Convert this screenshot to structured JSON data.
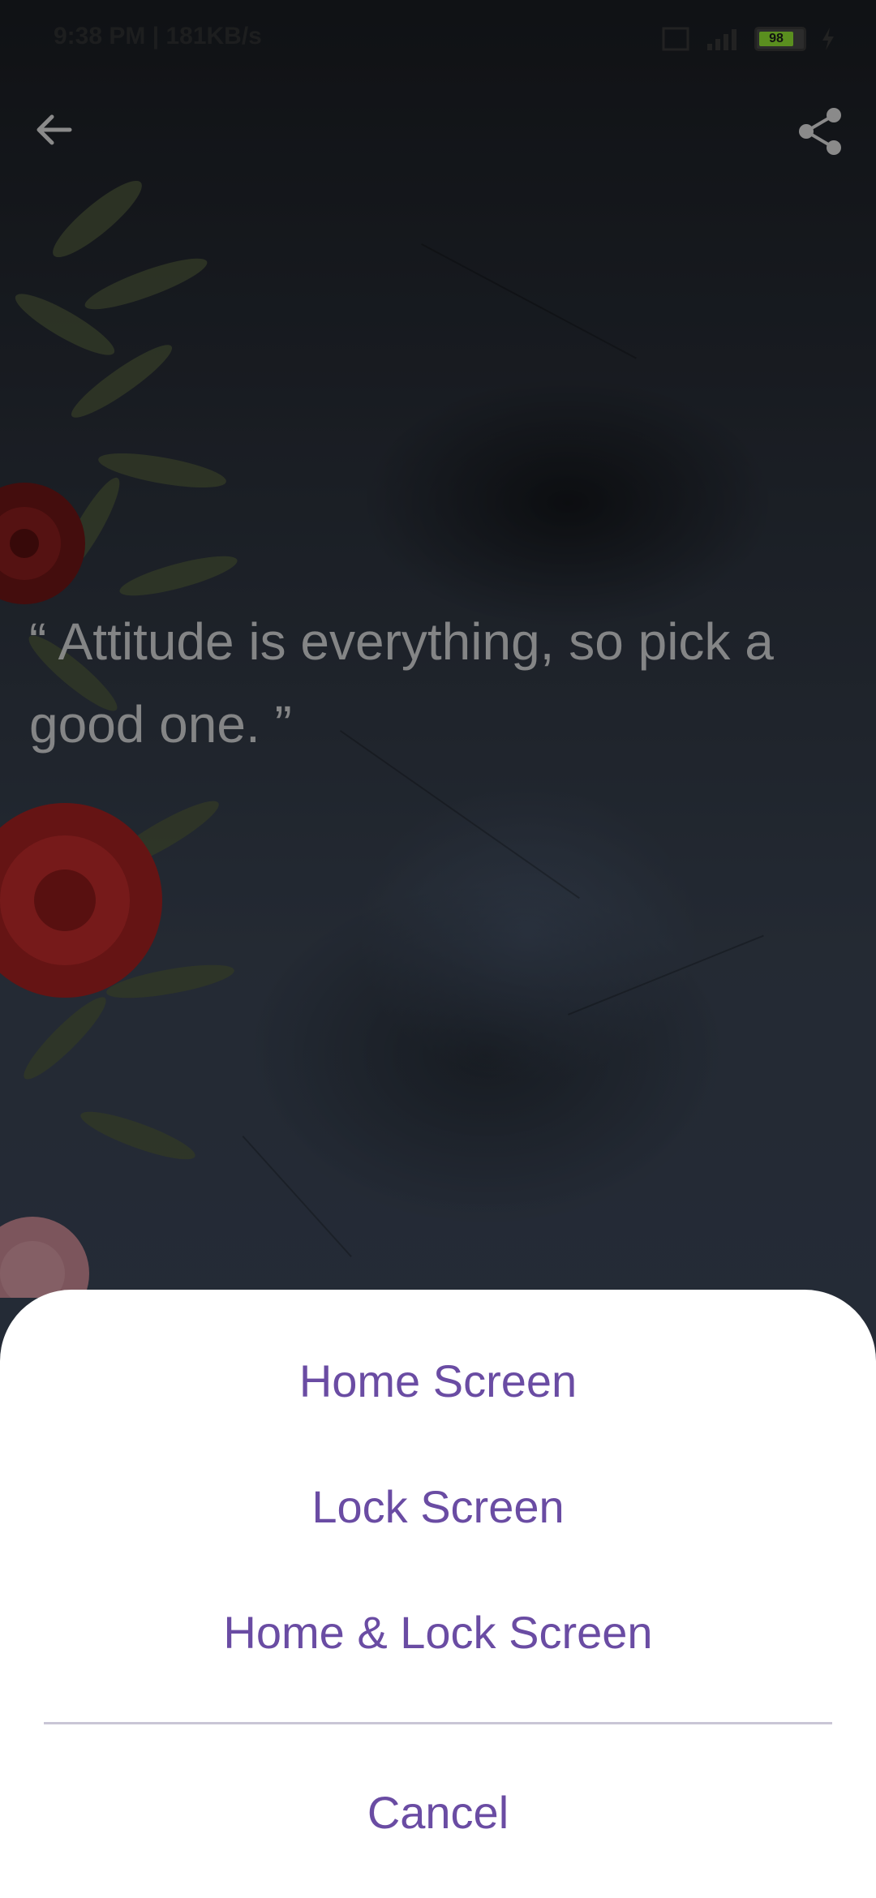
{
  "status_bar": {
    "time": "9:38 PM | 181KB/s",
    "battery": "98"
  },
  "quote": {
    "text": "“ Attitude is everything, so pick a good one. ”"
  },
  "sheet": {
    "home_screen": "Home Screen",
    "lock_screen": "Lock Screen",
    "home_and_lock": "Home & Lock Screen",
    "cancel": "Cancel"
  },
  "colors": {
    "accent": "#6a4ca3",
    "sheet_background": "#ffffff",
    "divider": "#c9c6d6"
  },
  "icons": {
    "back": "arrow-back-icon",
    "share": "share-icon"
  }
}
